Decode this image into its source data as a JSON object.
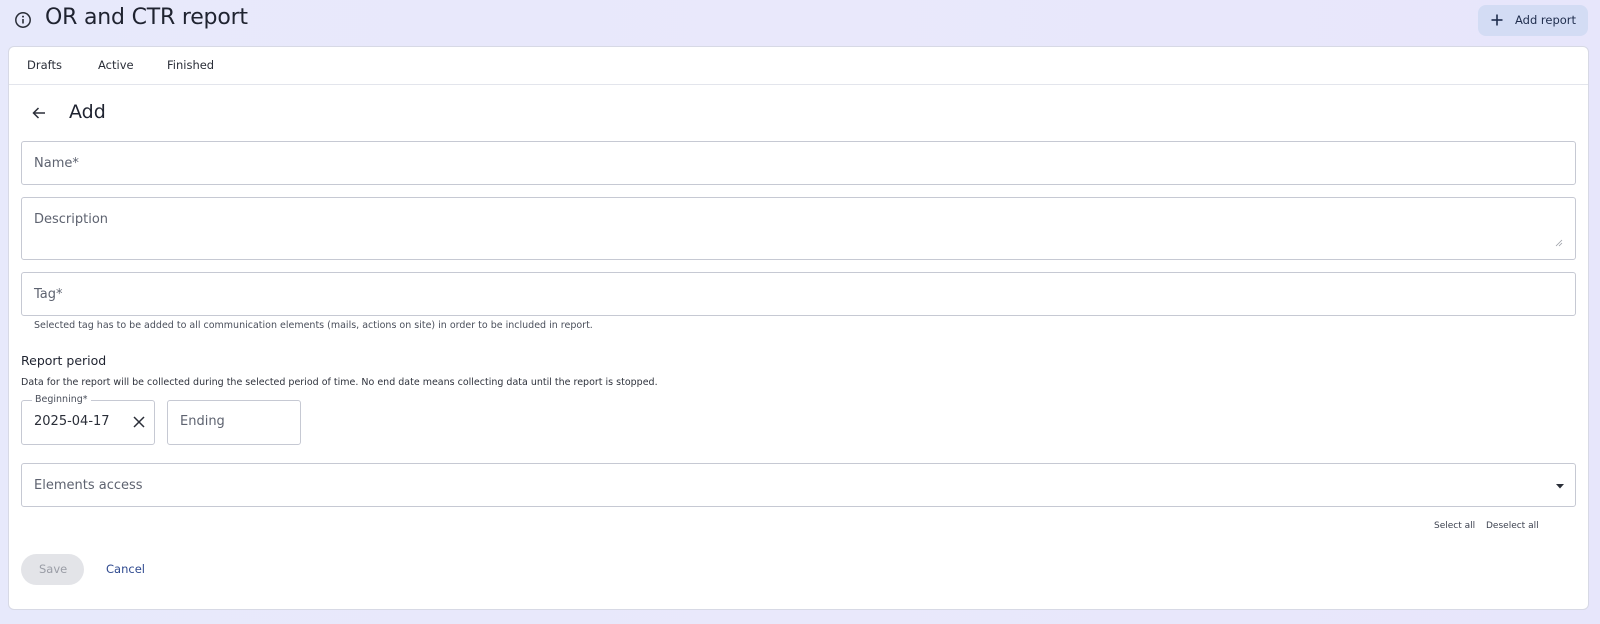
{
  "header": {
    "title": "OR and CTR report",
    "add_report_label": "Add report"
  },
  "tabs": [
    {
      "label": "Drafts"
    },
    {
      "label": "Active"
    },
    {
      "label": "Finished"
    }
  ],
  "form": {
    "title": "Add",
    "name_placeholder": "Name*",
    "description_placeholder": "Description",
    "tag_placeholder": "Tag*",
    "tag_helper": "Selected tag has to be added to all communication elements (mails, actions on site) in order to be included in report.",
    "report_period": {
      "title": "Report period",
      "description": "Data for the report will be collected during the selected period of time. No end date means collecting data until the report is stopped.",
      "beginning_label": "Beginning*",
      "beginning_value": "2025-04-17",
      "ending_placeholder": "Ending"
    },
    "elements_access_placeholder": "Elements access",
    "select_all_label": "Select all",
    "deselect_all_label": "Deselect all",
    "save_label": "Save",
    "cancel_label": "Cancel"
  },
  "icons": {
    "info": "info-icon",
    "plus": "plus-icon",
    "back": "arrow-left-icon",
    "clear": "close-icon",
    "dropdown": "caret-down-icon"
  },
  "colors": {
    "background": "#e7e9fb",
    "primary_button_bg": "#d3dcf4",
    "link": "#2f4a8f",
    "disabled_button_bg": "#e3e4e8"
  }
}
